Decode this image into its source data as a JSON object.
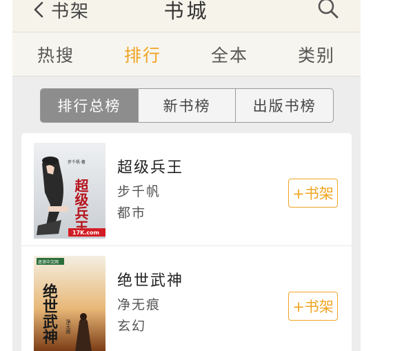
{
  "header": {
    "back_label": "书架",
    "title": "书城",
    "back_icon": "chevron-left-icon",
    "search_icon": "search-icon"
  },
  "tabs": [
    {
      "label": "热搜",
      "active": false
    },
    {
      "label": "排行",
      "active": true
    },
    {
      "label": "全本",
      "active": false
    },
    {
      "label": "类别",
      "active": false
    }
  ],
  "segments": [
    {
      "label": "排行总榜",
      "active": true
    },
    {
      "label": "新书榜",
      "active": false
    },
    {
      "label": "出版书榜",
      "active": false
    }
  ],
  "books": [
    {
      "title": "超级兵王",
      "author": "步千帆",
      "genre": "都市",
      "button": "+书架"
    },
    {
      "title": "绝世武神",
      "author": "净无痕",
      "genre": "玄幻",
      "button": "+书架"
    }
  ],
  "covers": {
    "cover1_title": "超级兵王",
    "cover1_author": "步千帆·著",
    "cover1_brand": "17K.com",
    "cover2_title": "绝世武神",
    "cover2_author": "净无痕",
    "cover2_brand": "逐浪中文网"
  },
  "colors": {
    "accent": "#f0a422",
    "header_bg": "#f6f3ea",
    "segment_active_bg": "#8d8d8d"
  }
}
